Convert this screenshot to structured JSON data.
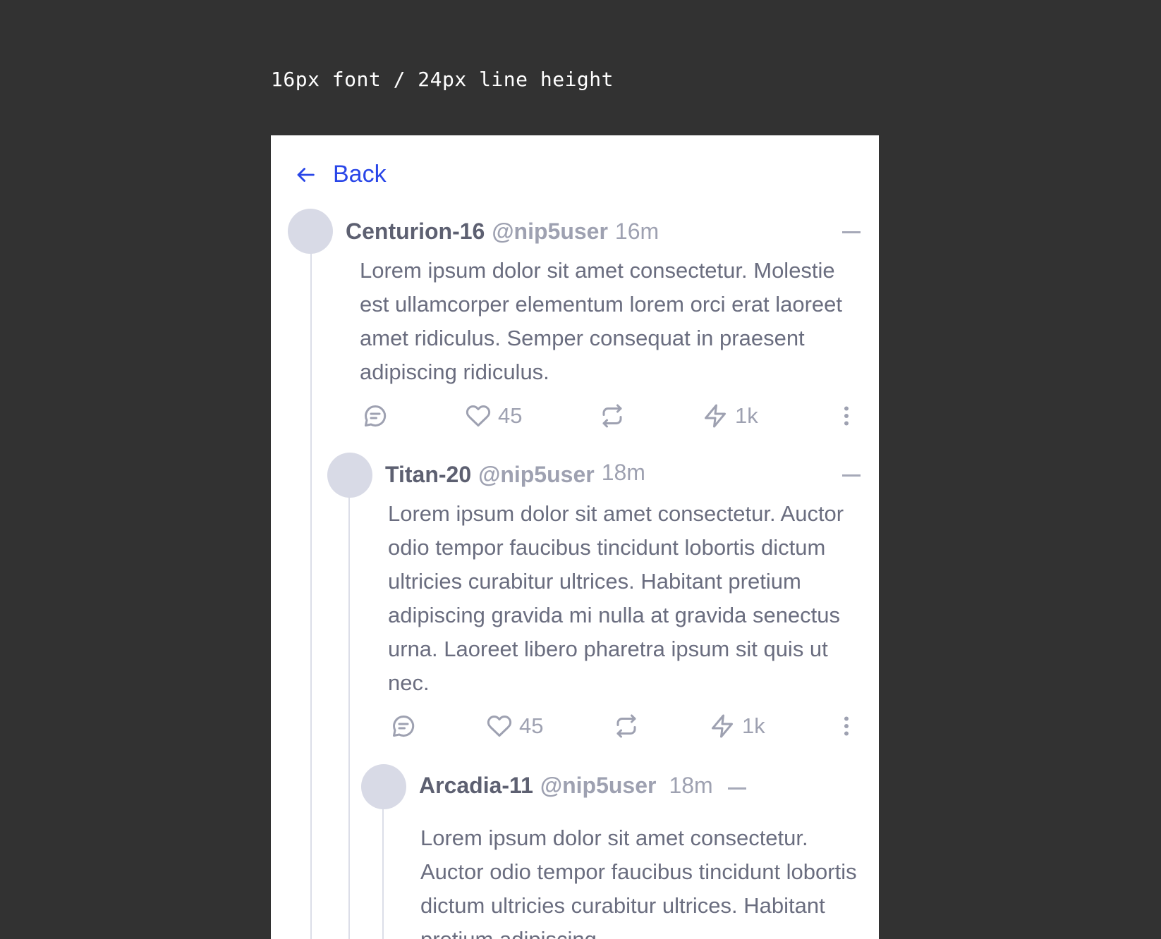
{
  "caption": "16px font / 24px line height",
  "nav": {
    "back_label": "Back"
  },
  "posts": [
    {
      "name": "Centurion-16",
      "handle": "@nip5user",
      "time": "16m",
      "text": "Lorem ipsum dolor sit amet consectetur. Molestie est ullamcorper elementum lorem orci erat laoreet amet ridiculus. Semper consequat in praesent adipiscing ridiculus.",
      "likes": "45",
      "zaps": "1k"
    },
    {
      "name": "Titan-20",
      "handle": "@nip5user",
      "time": "18m",
      "text": "Lorem ipsum dolor sit amet consectetur. Auctor odio tempor faucibus tincidunt lobortis dictum ultricies curabitur ultrices. Habitant pretium adipiscing gravida mi nulla at gravida senectus urna. Laoreet libero pharetra ipsum sit quis ut nec.",
      "likes": "45",
      "zaps": "1k"
    },
    {
      "name": "Arcadia-11",
      "handle": "@nip5user",
      "time": "18m",
      "text": "Lorem ipsum dolor sit amet consectetur. Auctor odio tempor faucibus tincidunt lobortis dictum ultricies curabitur ultrices. Habitant pretium adipiscing"
    }
  ],
  "colors": {
    "accent": "#2946e8",
    "background": "#323232",
    "card": "#ffffff",
    "avatar": "#d8dae6"
  }
}
